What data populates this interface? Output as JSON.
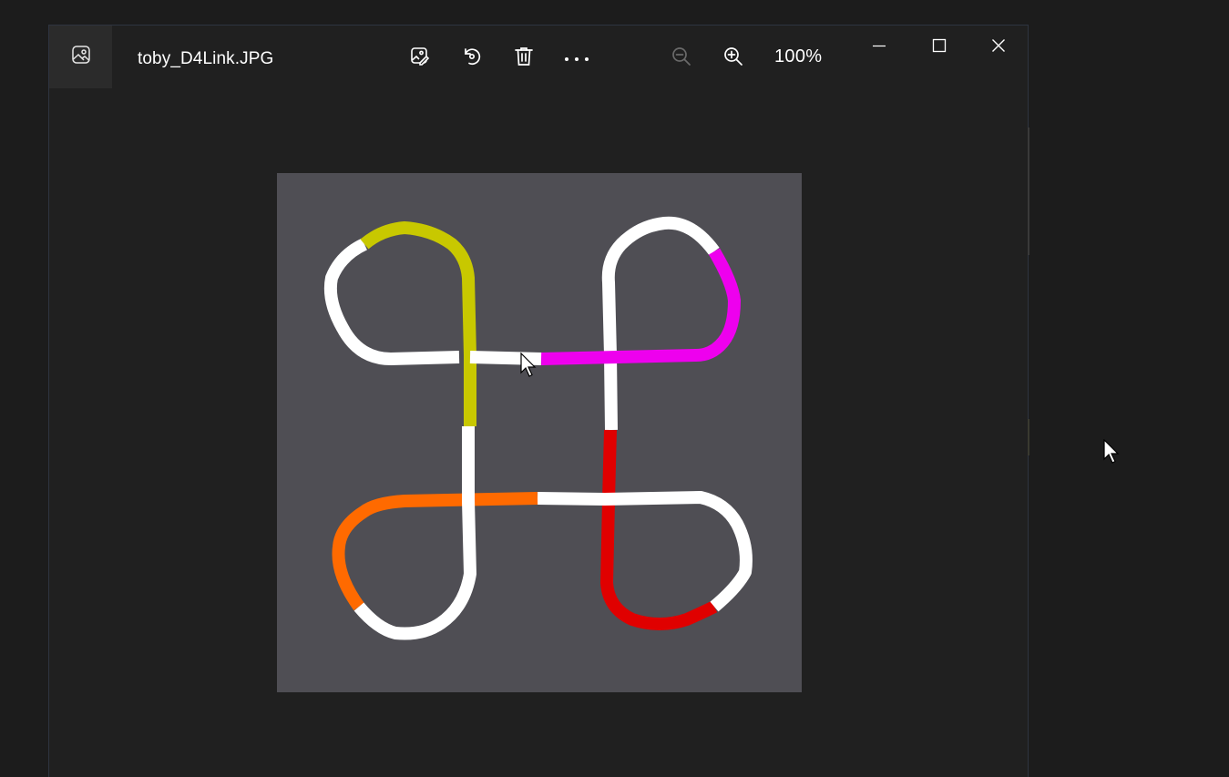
{
  "window": {
    "file_name": "toby_D4Link.JPG",
    "zoom_level": "100%"
  },
  "toolbar": {
    "icons": [
      "image-icon",
      "edit-image-icon",
      "rotate-icon",
      "delete-icon",
      "more-icon",
      "zoom-out-icon",
      "zoom-in-icon"
    ],
    "zoom_out_enabled": false
  },
  "window_controls": [
    "minimize-icon",
    "maximize-icon",
    "close-icon"
  ],
  "colors": {
    "background": "#202020",
    "photo_background": "#4f4e54",
    "strand_white": "#ffffff",
    "strand_yellow": "#c8c800",
    "strand_magenta": "#ee00ee",
    "strand_red": "#e00000",
    "strand_orange": "#ff6a00"
  }
}
